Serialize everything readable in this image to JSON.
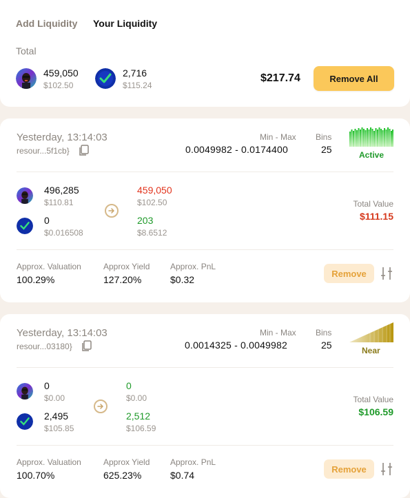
{
  "tabs": [
    {
      "label": "Add Liquidity",
      "active": false
    },
    {
      "label": "Your Liquidity",
      "active": true
    }
  ],
  "summary": {
    "total_label": "Total",
    "token_a": {
      "amount": "459,050",
      "usd": "$102.50",
      "icon": "meme-token-avatar"
    },
    "token_b": {
      "amount": "2,716",
      "usd": "$115.24",
      "icon": "check-token-avatar"
    },
    "total_value": "$217.74",
    "remove_all_label": "Remove All"
  },
  "positions": [
    {
      "timestamp": "Yesterday, 13:14:03",
      "resource": "resour...5f1cb}",
      "range_label": "Min - Max",
      "range": "0.0049982 - 0.0174400",
      "bins_label": "Bins",
      "bins": "25",
      "status": "Active",
      "status_color": "#1f9a2a",
      "token_a": {
        "amount": "496,285",
        "usd": "$110.81"
      },
      "token_b": {
        "amount": "0",
        "usd": "$0.016508"
      },
      "out_a": {
        "amount": "459,050",
        "usd": "$102.50",
        "color": "#e2341d"
      },
      "out_b": {
        "amount": "203",
        "usd": "$8.6512",
        "color": "#1f9a2a"
      },
      "total_value_label": "Total Value",
      "total_value": "$111.15",
      "total_value_color": "#d63a1e",
      "metrics": [
        {
          "label": "Approx. Valuation",
          "value": "100.29%"
        },
        {
          "label": "Approx Yield",
          "value": "127.20%"
        },
        {
          "label": "Approx. PnL",
          "value": "$0.32"
        }
      ],
      "remove_label": "Remove"
    },
    {
      "timestamp": "Yesterday, 13:14:03",
      "resource": "resour...03180}",
      "range_label": "Min - Max",
      "range": "0.0014325 - 0.0049982",
      "bins_label": "Bins",
      "bins": "25",
      "status": "Near",
      "status_color": "#8a7a1a",
      "token_a": {
        "amount": "0",
        "usd": "$0.00"
      },
      "token_b": {
        "amount": "2,495",
        "usd": "$105.85"
      },
      "out_a": {
        "amount": "0",
        "usd": "$0.00",
        "color": "#1f9a2a"
      },
      "out_b": {
        "amount": "2,512",
        "usd": "$106.59",
        "color": "#1f9a2a"
      },
      "total_value_label": "Total Value",
      "total_value": "$106.59",
      "total_value_color": "#1f9a2a",
      "metrics": [
        {
          "label": "Approx. Valuation",
          "value": "100.70%"
        },
        {
          "label": "Approx Yield",
          "value": "625.23%"
        },
        {
          "label": "Approx. PnL",
          "value": "$0.74"
        }
      ],
      "remove_label": "Remove"
    }
  ]
}
